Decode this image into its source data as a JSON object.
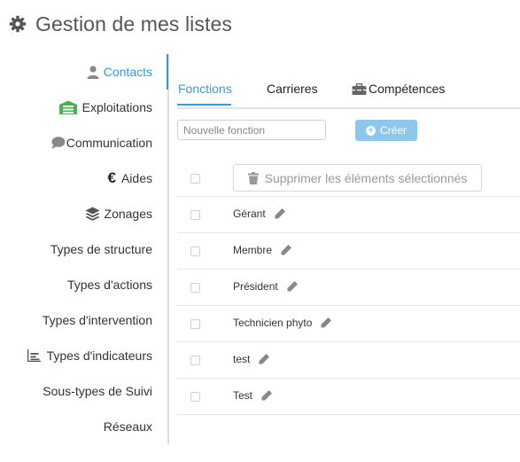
{
  "page": {
    "title": "Gestion de mes listes",
    "icon": "gear-icon"
  },
  "colors": {
    "accent": "#3a98d8",
    "create_button": "#8ec7ee",
    "exploitations_icon": "#4caf50"
  },
  "sidebar": {
    "items": [
      {
        "label": "Contacts",
        "icon": "user-icon",
        "active": true
      },
      {
        "label": "Exploitations",
        "icon": "farm-icon"
      },
      {
        "label": "Communication",
        "icon": "chat-bubble-icon"
      },
      {
        "label": "Aides",
        "icon": "euro-icon"
      },
      {
        "label": "Zonages",
        "icon": "layers-icon"
      },
      {
        "label": "Types de structure"
      },
      {
        "label": "Types d'actions"
      },
      {
        "label": "Types d'intervention"
      },
      {
        "label": "Types d'indicateurs",
        "icon": "chart-icon"
      },
      {
        "label": "Sous-types de Suivi"
      },
      {
        "label": "Réseaux"
      }
    ]
  },
  "tabs": [
    {
      "label": "Fonctions",
      "active": true
    },
    {
      "label": "Carrieres"
    },
    {
      "label": "Compétences",
      "icon": "toolbox-icon"
    }
  ],
  "form": {
    "placeholder": "Nouvelle fonction",
    "create_label": "Créer"
  },
  "table": {
    "delete_label": "Supprimer les éléments sélectionnés",
    "rows": [
      "Gérant",
      "Membre",
      "Président",
      "Technicien phyto",
      "test",
      "Test"
    ]
  }
}
